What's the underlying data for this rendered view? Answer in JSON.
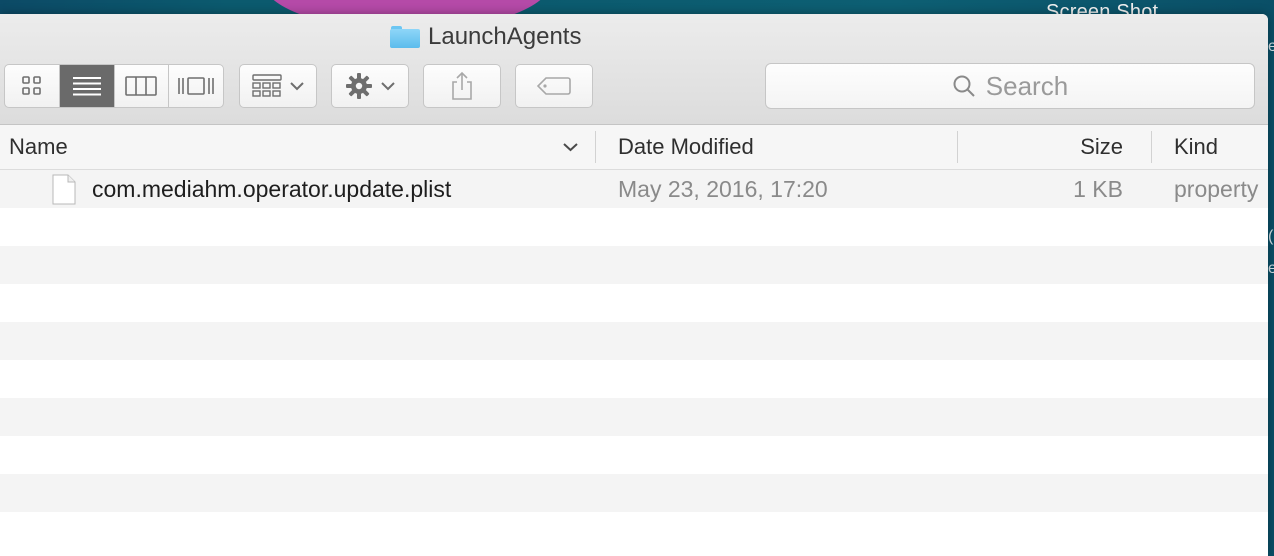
{
  "wallpaper": {
    "overlay_text": "Screen Shot",
    "side_glyphs": [
      "e",
      "(",
      "e"
    ]
  },
  "window": {
    "title": "LaunchAgents",
    "title_icon": "folder-icon"
  },
  "toolbar": {
    "view_modes": [
      {
        "name": "icon-view",
        "icon": "grid-icon",
        "active": false
      },
      {
        "name": "list-view",
        "icon": "list-icon",
        "active": true
      },
      {
        "name": "column-view",
        "icon": "columns-icon",
        "active": false
      },
      {
        "name": "cover-flow-view",
        "icon": "cover-flow-icon",
        "active": false
      }
    ],
    "arrange_icon": "arrange-icon",
    "action_icon": "gear-icon",
    "share_icon": "share-icon",
    "tag_icon": "tag-icon",
    "search_placeholder": "Search"
  },
  "columns": {
    "name": "Name",
    "date_modified": "Date Modified",
    "size": "Size",
    "kind": "Kind"
  },
  "files": [
    {
      "name": "com.mediahm.operator.update.plist",
      "date_modified": "May 23, 2016, 17:20",
      "size": "1 KB",
      "kind": "property"
    }
  ],
  "colors": {
    "active_segment": "#6a6a6a",
    "row_alt": "#f4f4f4",
    "folder": "#6cc6f2"
  }
}
